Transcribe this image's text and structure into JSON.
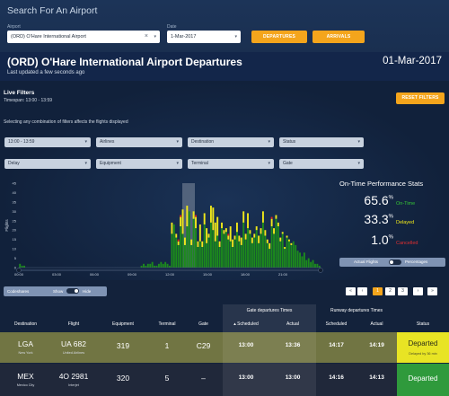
{
  "search": {
    "title": "Search For An Airport",
    "airport_label": "Airport",
    "airport_value": "(ORD) O'Hare International Airport",
    "date_label": "Date",
    "date_value": "1-Mar-2017",
    "departures_label": "DEPARTURES",
    "arrivals_label": "ARRIVALS"
  },
  "header": {
    "title": "(ORD) O'Hare International Airport Departures",
    "updated": "Last updated a few seconds ago",
    "date": "01-Mar-2017"
  },
  "filters": {
    "title": "Live Filters",
    "timespan": "Timespan: 13:00 - 13:59",
    "reset_label": "RESET FILTERS",
    "hint": "Selecting any combination of filters affects the flights displayed",
    "dropdowns": [
      "13:00 - 13:59",
      "Airlines",
      "Destination",
      "Status",
      "Delay",
      "Equipment",
      "Terminal",
      "Gate"
    ]
  },
  "stats": {
    "title": "On-Time Performance Stats",
    "on_time_value": "65.6",
    "on_time_label": "On-Time",
    "delayed_value": "33.3",
    "delayed_label": "Delayed",
    "cancelled_value": "1.0",
    "cancelled_label": "Cancelled",
    "pct_symbol": "%",
    "toggle_left": "Actual Flights",
    "toggle_right": "Percentages"
  },
  "colors": {
    "on_time": "#1c8b1c",
    "delayed": "#f0e81a",
    "cancelled": "#e02020",
    "accent": "#f4a51c"
  },
  "chart_data": {
    "type": "bar",
    "stacked": true,
    "ylabel": "Flights",
    "ylim": [
      0,
      45
    ],
    "yticks": [
      "45",
      "40",
      "35",
      "30",
      "25",
      "20",
      "15",
      "10",
      "5",
      "0"
    ],
    "xticks": [
      "00:00",
      "03:00",
      "06:00",
      "09:00",
      "12:00",
      "15:00",
      "18:00",
      "21:00"
    ],
    "highlight_hour": "13:00",
    "series": [
      {
        "name": "On-Time",
        "values": [
          2,
          1,
          1,
          0,
          0,
          0,
          0,
          0,
          0,
          0,
          0,
          0,
          0,
          0,
          0,
          0,
          0,
          0,
          0,
          0,
          0,
          0,
          0,
          0,
          0,
          0,
          0,
          0,
          0,
          0,
          0,
          0,
          0,
          0,
          0,
          0,
          0,
          0,
          0,
          0,
          0,
          0,
          0,
          0,
          0,
          0,
          0,
          0,
          0,
          0,
          0,
          0,
          0,
          0,
          0,
          0,
          1,
          2,
          1,
          2,
          2,
          3,
          1,
          1,
          2,
          3,
          2,
          3,
          2,
          1,
          18,
          23,
          16,
          12,
          22,
          18,
          12,
          22,
          30,
          12,
          26,
          21,
          11,
          14,
          11,
          23,
          13,
          16,
          24,
          20,
          14,
          17,
          11,
          21,
          18,
          19,
          15,
          14,
          11,
          15,
          19,
          14,
          12,
          24,
          15,
          21,
          18,
          13,
          16,
          20,
          13,
          18,
          24,
          17,
          13,
          10,
          22,
          18,
          26,
          22,
          14,
          18,
          10,
          16,
          14,
          12,
          14,
          12,
          9,
          8,
          6,
          8,
          4,
          5,
          3,
          4,
          2,
          2,
          1
        ]
      },
      {
        "name": "Delayed",
        "values": [
          0,
          0,
          0,
          0,
          0,
          0,
          0,
          0,
          0,
          0,
          0,
          0,
          0,
          0,
          0,
          0,
          0,
          0,
          0,
          0,
          0,
          0,
          0,
          0,
          0,
          0,
          0,
          0,
          0,
          0,
          0,
          0,
          0,
          0,
          0,
          0,
          0,
          0,
          0,
          0,
          0,
          0,
          0,
          0,
          0,
          0,
          0,
          0,
          0,
          0,
          0,
          0,
          0,
          0,
          0,
          0,
          0,
          0,
          0,
          0,
          0,
          0,
          0,
          0,
          0,
          0,
          0,
          0,
          0,
          0,
          6,
          0,
          2,
          2,
          5,
          13,
          4,
          11,
          0,
          3,
          4,
          6,
          3,
          9,
          3,
          6,
          8,
          2,
          9,
          12,
          10,
          10,
          3,
          3,
          2,
          2,
          2,
          8,
          4,
          2,
          5,
          3,
          4,
          6,
          3,
          8,
          2,
          3,
          2,
          2,
          4,
          3,
          6,
          3,
          2,
          3,
          4,
          3,
          2,
          2,
          2,
          1,
          1,
          1,
          1,
          1,
          0,
          0,
          0,
          0,
          0,
          0,
          0,
          0,
          0,
          0,
          0,
          0,
          0
        ]
      },
      {
        "name": "Cancelled",
        "values": [
          0,
          0,
          0,
          0,
          0,
          0,
          0,
          0,
          0,
          0,
          0,
          0,
          0,
          0,
          0,
          0,
          0,
          0,
          0,
          0,
          0,
          0,
          0,
          0,
          0,
          0,
          0,
          0,
          0,
          0,
          0,
          0,
          0,
          0,
          0,
          0,
          0,
          0,
          0,
          0,
          0,
          0,
          0,
          0,
          0,
          0,
          0,
          0,
          0,
          0,
          0,
          0,
          0,
          0,
          0,
          0,
          0,
          0,
          0,
          0,
          0,
          0,
          0,
          0,
          0,
          0,
          0,
          0,
          0,
          0,
          0,
          0,
          0,
          1,
          1,
          0,
          0,
          0,
          0,
          0,
          0,
          1,
          0,
          0,
          0,
          0,
          0,
          0,
          0,
          0,
          0,
          0,
          0,
          0,
          0,
          0,
          1,
          0,
          0,
          0,
          0,
          0,
          0,
          0,
          0,
          0,
          0,
          0,
          0,
          0,
          0,
          0,
          0,
          0,
          0,
          0,
          1,
          0,
          0,
          0,
          0,
          0,
          0,
          0,
          0,
          0,
          0,
          0,
          0,
          0,
          0,
          0,
          0,
          0,
          0,
          0,
          0,
          0,
          0
        ]
      }
    ]
  },
  "codeshares": {
    "label": "Codeshares",
    "show": "Show",
    "hide": "Hide"
  },
  "pagination": {
    "items": [
      "«",
      "‹",
      "1",
      "2",
      "3",
      "›",
      "»"
    ],
    "active": "1"
  },
  "table": {
    "group_gate": "Gate departures Times",
    "group_runway": "Runway departures Times",
    "columns": [
      "Destination",
      "Flight",
      "Equipment",
      "Terminal",
      "Gate",
      "▴ Scheduled",
      "Actual",
      "Scheduled",
      "Actual",
      "Status"
    ],
    "rows": [
      {
        "dest": "LGA",
        "dest_city": "New York",
        "flight": "UA 682",
        "airline": "United Airlines",
        "equipment": "319",
        "terminal": "1",
        "gate": "C29",
        "gate_sched": "13:00",
        "gate_actual": "13:36",
        "rwy_sched": "14:17",
        "rwy_actual": "14:19",
        "status": "Departed",
        "status_note": "Delayed by 36 min"
      },
      {
        "dest": "MEX",
        "dest_city": "Mexico City",
        "flight": "4O 2981",
        "airline": "Interjet",
        "equipment": "320",
        "terminal": "5",
        "gate": "–",
        "gate_sched": "13:00",
        "gate_actual": "13:00",
        "rwy_sched": "14:16",
        "rwy_actual": "14:13",
        "status": "Departed",
        "status_note": ""
      }
    ]
  }
}
